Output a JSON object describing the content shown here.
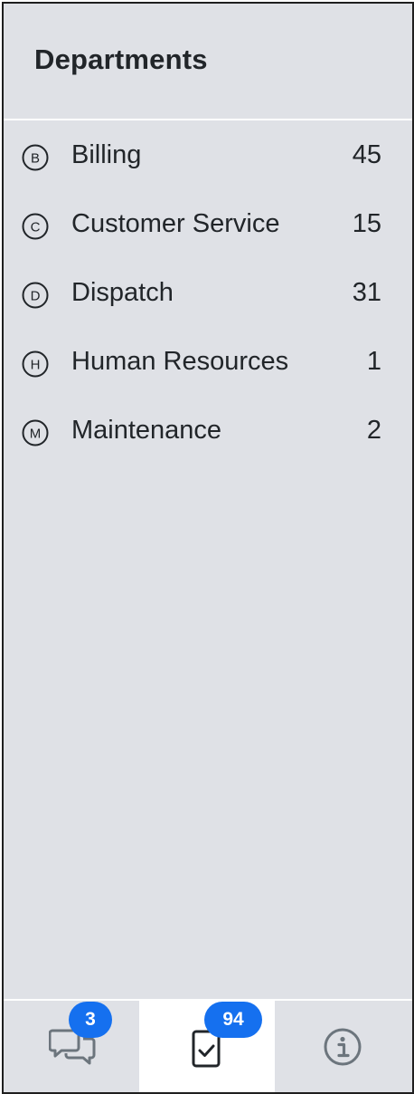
{
  "header": {
    "title": "Departments"
  },
  "departments": [
    {
      "letter": "B",
      "label": "Billing",
      "count": "45",
      "icon": "letter-b-circle-icon"
    },
    {
      "letter": "C",
      "label": "Customer Service",
      "count": "15",
      "icon": "letter-c-circle-icon"
    },
    {
      "letter": "D",
      "label": "Dispatch",
      "count": "31",
      "icon": "letter-d-circle-icon"
    },
    {
      "letter": "H",
      "label": "Human Resources",
      "count": "1",
      "icon": "letter-h-circle-icon"
    },
    {
      "letter": "M",
      "label": "Maintenance",
      "count": "2",
      "icon": "letter-m-circle-icon"
    }
  ],
  "tabbar": {
    "tabs": [
      {
        "id": "chats",
        "icon": "chat-bubbles-icon",
        "badge": "3",
        "active": false
      },
      {
        "id": "tasks",
        "icon": "clipboard-check-icon",
        "badge": "94",
        "active": true
      },
      {
        "id": "info",
        "icon": "info-circle-icon",
        "badge": "",
        "active": false
      }
    ]
  },
  "colors": {
    "panel_background": "#dfe1e6",
    "active_tab_background": "#ffffff",
    "badge": "#1570ef",
    "text": "#212529",
    "inactive_icon": "#6c757d"
  }
}
